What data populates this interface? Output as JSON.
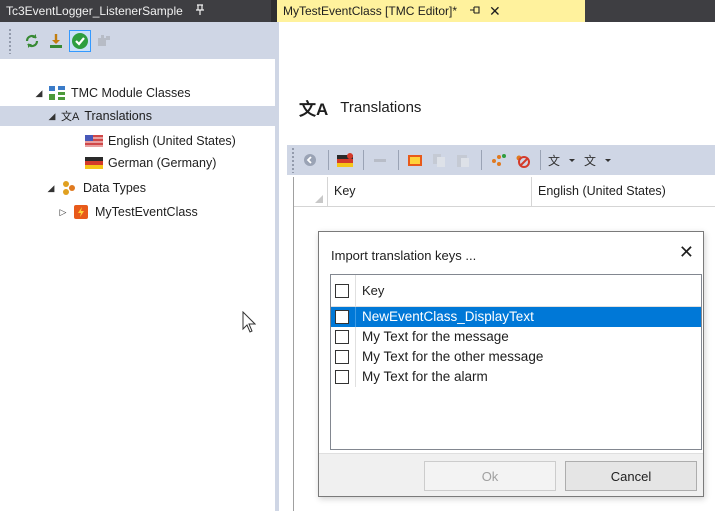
{
  "tabs": {
    "left": {
      "title": "Tc3EventLogger_ListenerSample",
      "pin": "♂"
    },
    "right": {
      "title": "MyTestEventClass [TMC Editor]*",
      "pin": "⊟",
      "close": "✕"
    }
  },
  "tree": {
    "root": {
      "label": "TMC Module Classes",
      "expander": "◢"
    },
    "translations": {
      "label": "Translations",
      "expander": "◢",
      "icon_char": "文A"
    },
    "english": {
      "label": "English (United States)"
    },
    "german": {
      "label": "German (Germany)"
    },
    "datatypes": {
      "label": "Data Types",
      "expander": "◢"
    },
    "class": {
      "label": "MyTestEventClass",
      "expander": "▷"
    }
  },
  "editor": {
    "title": "Translations",
    "title_icon_char": "文A",
    "grid": {
      "columns": [
        "Key",
        "English (United States)"
      ]
    }
  },
  "dialog": {
    "title": "Import translation keys ...",
    "close": "✕",
    "list_header": "Key",
    "items": [
      {
        "label": "NewEventClass_DisplayText",
        "selected": true
      },
      {
        "label": "My Text for the message",
        "selected": false
      },
      {
        "label": "My Text for the other message",
        "selected": false
      },
      {
        "label": "My Text for the alarm",
        "selected": false
      }
    ],
    "ok_label": "Ok",
    "cancel_label": "Cancel"
  },
  "colors": {
    "tab_active": "#fff29d",
    "tabstrip": "#3e3e42",
    "toolbar": "#cfd6e5",
    "selection": "#0078d7"
  },
  "icons": {
    "left_toolbar": [
      "refresh-icon",
      "download-icon",
      "check-icon",
      "plugin-icon"
    ],
    "editor_toolbar": [
      "back-icon",
      "add-language-icon",
      "remove-icon",
      "import-icon",
      "copy-icon",
      "paste-icon",
      "add-key-icon",
      "remove-key-icon",
      "translate-import-icon",
      "translate-export-icon"
    ]
  }
}
